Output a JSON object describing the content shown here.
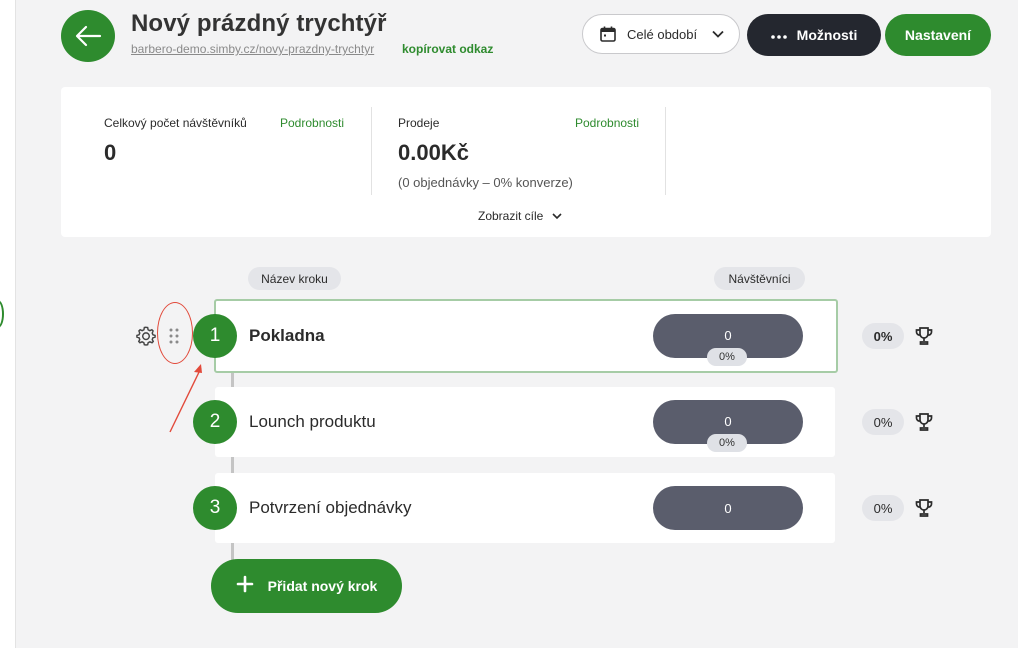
{
  "header": {
    "title": "Nový prázdný trychtýř",
    "url": "barbero-demo.simby.cz/novy-prazdny-trychtyr",
    "copy_link": "kopírovat odkaz",
    "period_label": "Celé období",
    "options_label": "Možnosti",
    "settings_label": "Nastavení"
  },
  "stats": {
    "visitors": {
      "label": "Celkový počet návštěvníků",
      "link": "Podrobnosti",
      "value": "0"
    },
    "sales": {
      "label": "Prodeje",
      "link": "Podrobnosti",
      "value": "0.00Kč",
      "note": "(0 objednávky – 0% konverze)"
    },
    "goals_toggle": "Zobrazit cíle"
  },
  "columns": {
    "step_name": "Název kroku",
    "visitors": "Návštěvníci"
  },
  "steps": [
    {
      "number": "1",
      "name": "Pokladna",
      "visitors": "0",
      "rate": "0%",
      "conversion": "0%"
    },
    {
      "number": "2",
      "name": "Lounch produktu",
      "visitors": "0",
      "rate": "0%",
      "conversion": "0%"
    },
    {
      "number": "3",
      "name": "Potvrzení objednávky",
      "visitors": "0",
      "conversion": "0%"
    }
  ],
  "add_step_label": "Přidat nový krok",
  "icons": {
    "back": "arrow-left-icon",
    "calendar": "calendar-icon",
    "chevron": "chevron-down-icon",
    "options": "more-horizontal-icon",
    "gear": "gear-icon",
    "drag": "drag-handle-icon",
    "trophy": "trophy-icon",
    "plus": "plus-icon"
  },
  "colors": {
    "accent": "#2e8b2e",
    "dark_button": "#24272f",
    "pill": "#5a5d6c",
    "annotation": "#e24a3b"
  }
}
